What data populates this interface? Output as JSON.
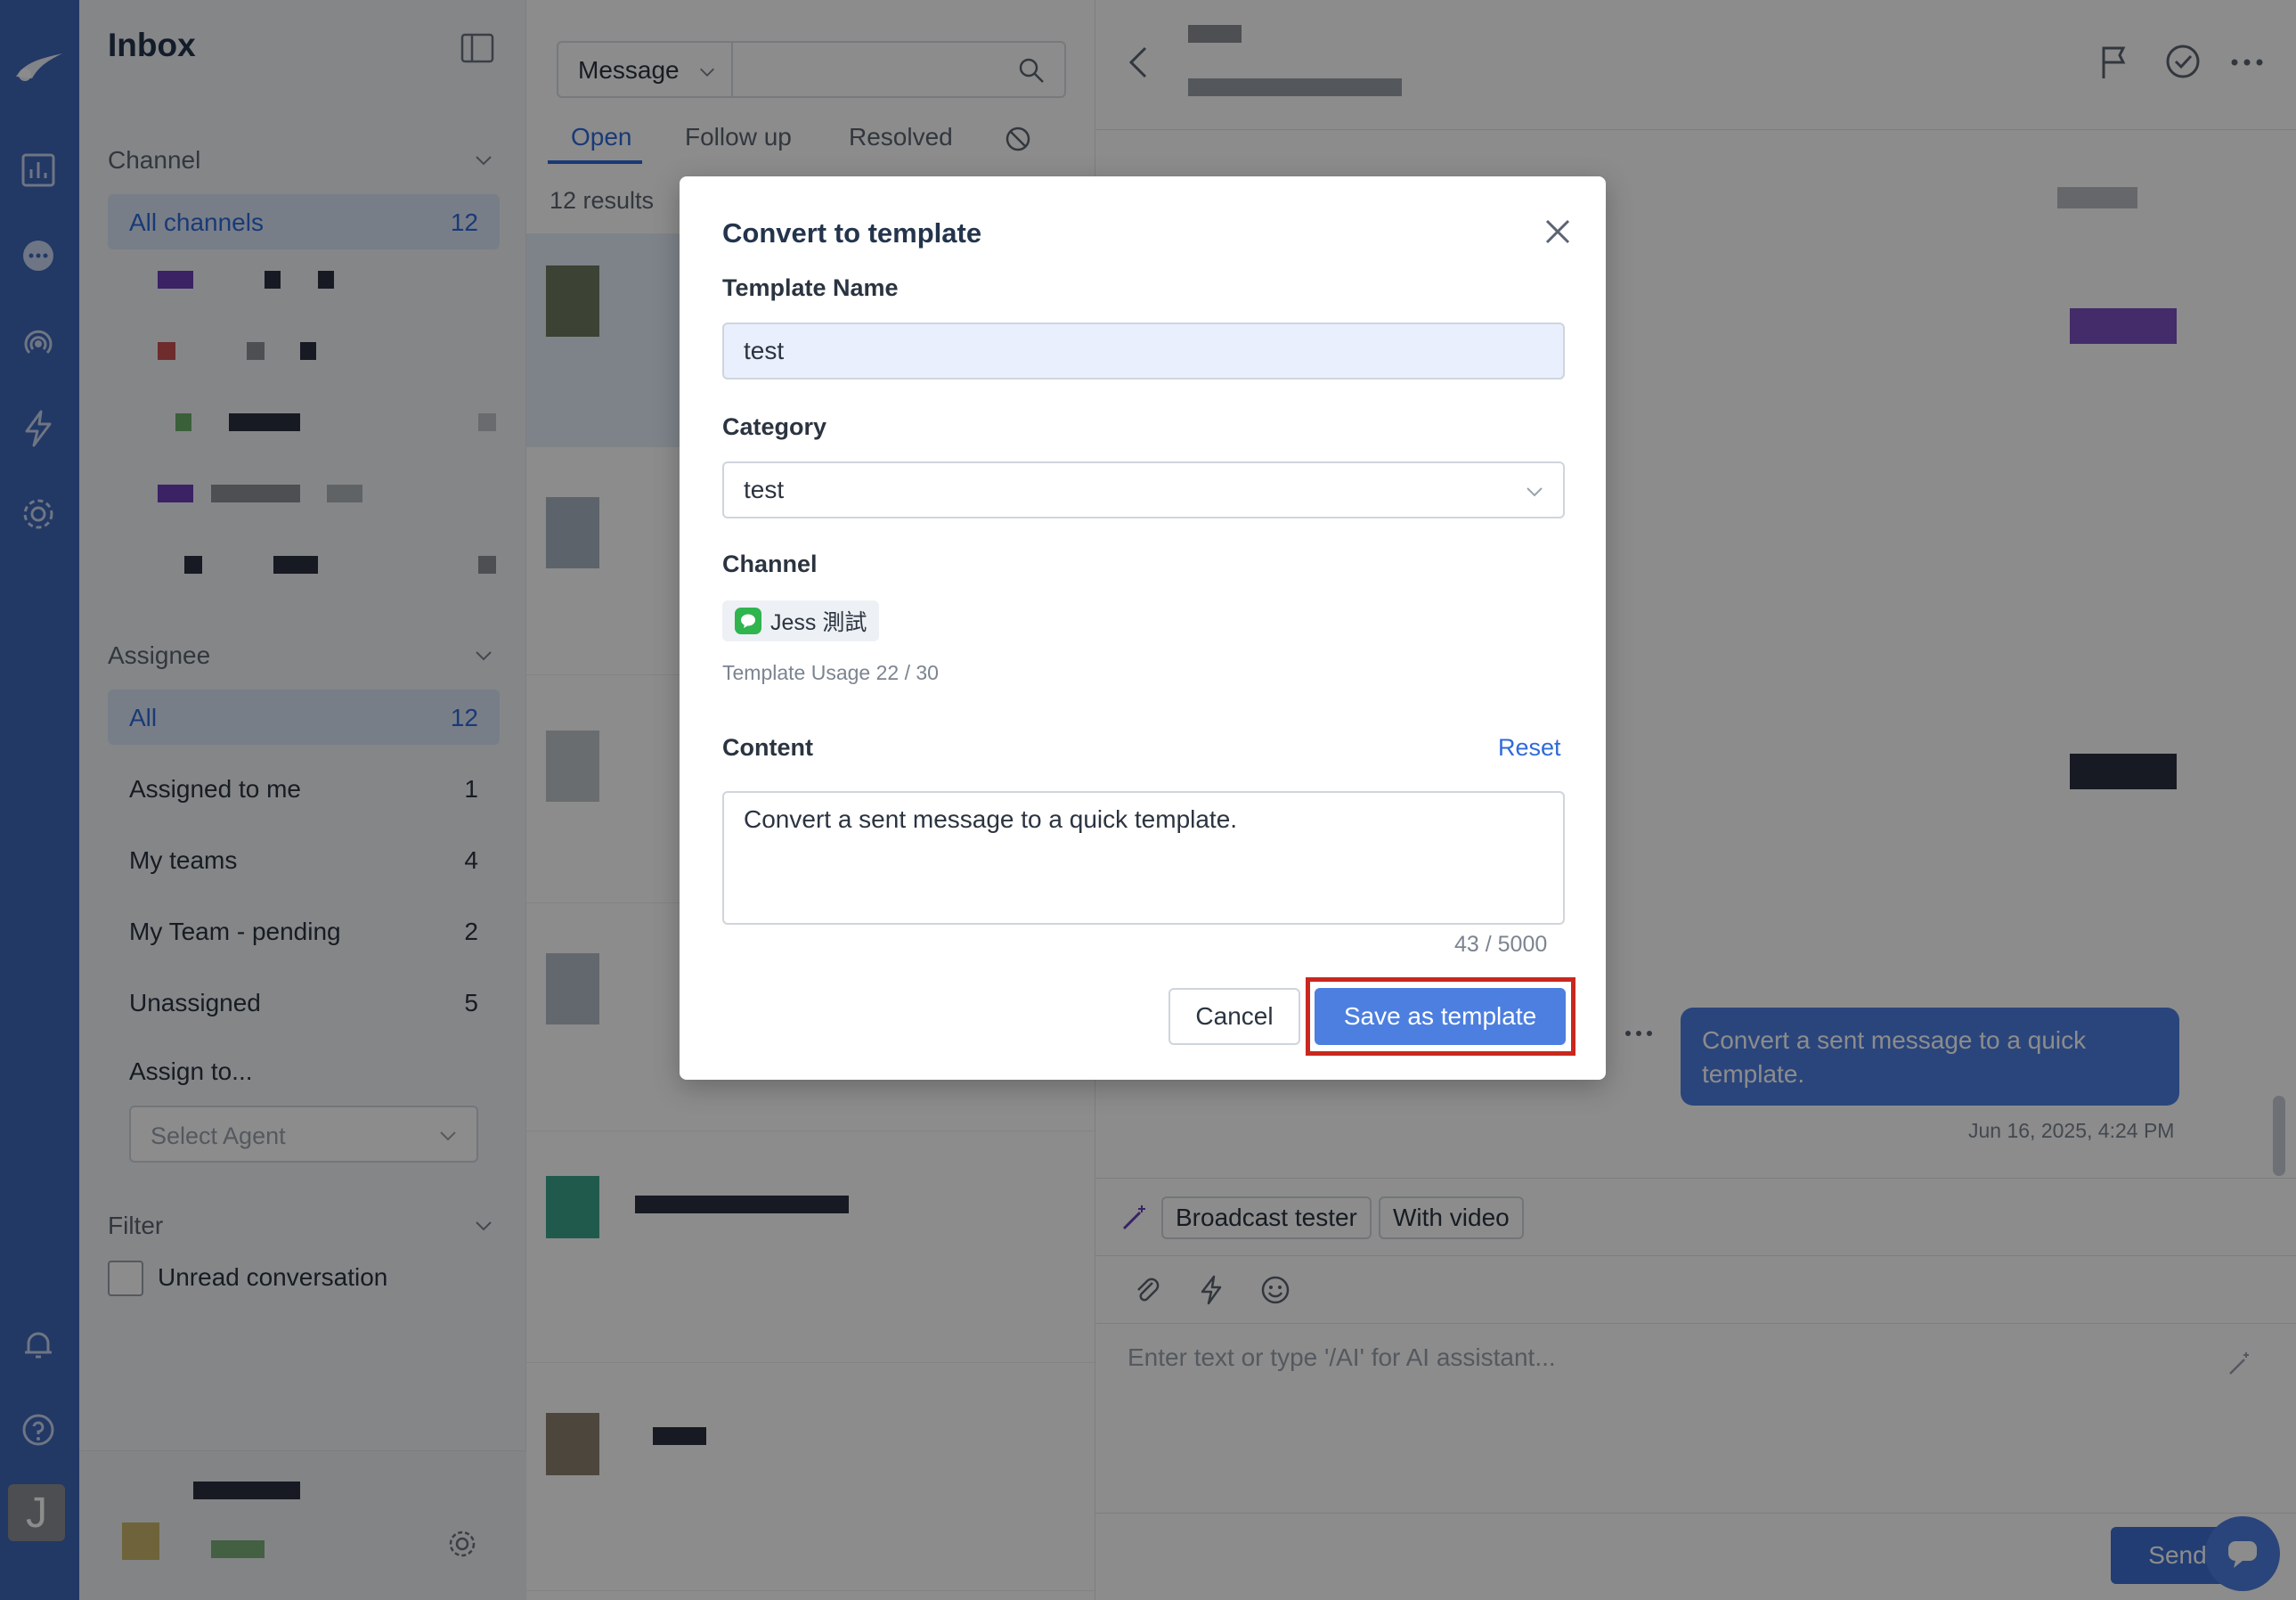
{
  "sidebar": {
    "title": "Inbox",
    "channel_section": "Channel",
    "all_channels": {
      "label": "All channels",
      "count": "12"
    },
    "assignee_section": "Assignee",
    "assignee_items": [
      {
        "label": "All",
        "count": "12"
      },
      {
        "label": "Assigned to me",
        "count": "1"
      },
      {
        "label": "My teams",
        "count": "4"
      },
      {
        "label": "My Team - pending",
        "count": "2"
      },
      {
        "label": "Unassigned",
        "count": "5"
      }
    ],
    "assign_to": "Assign to...",
    "select_agent_placeholder": "Select Agent",
    "filter_section": "Filter",
    "unread_label": "Unread conversation"
  },
  "list": {
    "search_type": "Message",
    "tabs": [
      "Open",
      "Follow up",
      "Resolved"
    ],
    "results": "12 results"
  },
  "chat": {
    "bubble_text": "Convert a sent message to a quick template.",
    "timestamp": "Jun 16, 2025, 4:24 PM",
    "chips": [
      "Broadcast tester",
      "With video"
    ],
    "composer_placeholder": "Enter text or type '/AI' for AI assistant...",
    "send_label": "Send"
  },
  "modal": {
    "title": "Convert to template",
    "template_name_label": "Template Name",
    "template_name_value": "test",
    "category_label": "Category",
    "category_value": "test",
    "channel_label": "Channel",
    "channel_name": "Jess 測試",
    "template_usage": "Template Usage 22 / 30",
    "content_label": "Content",
    "reset_label": "Reset",
    "content_value": "Convert a sent message to a quick template.",
    "char_count": "43 / 5000",
    "cancel_label": "Cancel",
    "save_label": "Save as template"
  },
  "colors": {
    "rail": "#3f66b8",
    "accent": "#4d7fe0",
    "highlight": "#c9281e",
    "line_green": "#2fb44e"
  }
}
